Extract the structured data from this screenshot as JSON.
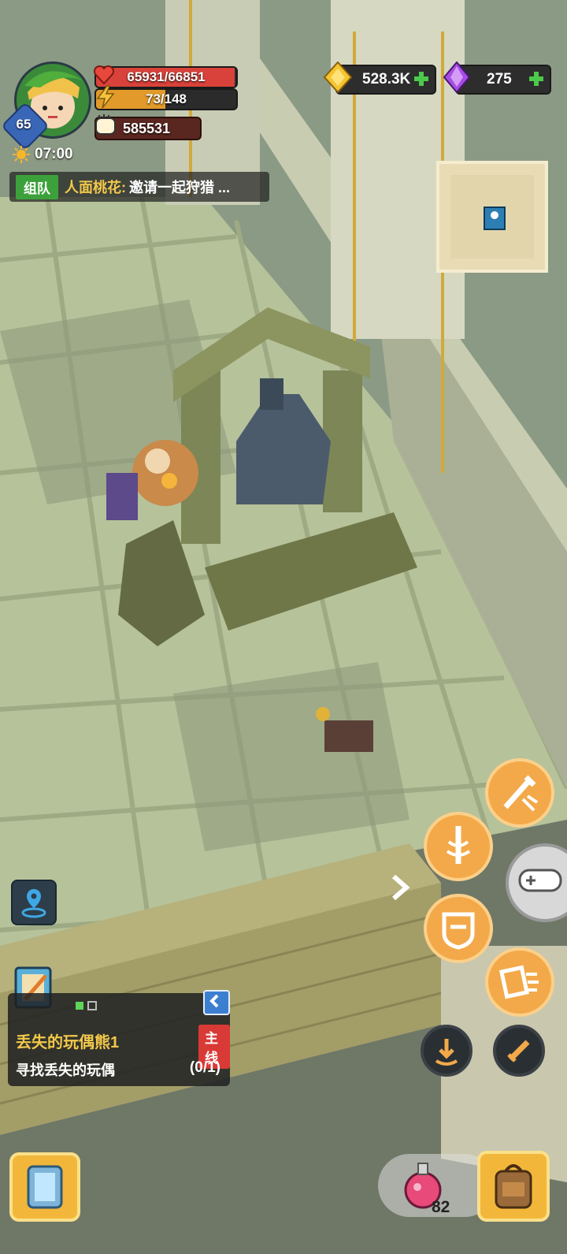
{
  "player": {
    "level": "65",
    "hp_text": "65931/66851",
    "hp_fraction": 0.986,
    "energy_text": "73/148",
    "energy_fraction": 0.493,
    "power": "585531",
    "time": "07:00"
  },
  "chat": {
    "channel": "组队",
    "sender": "人面桃花:",
    "message": "邀请一起狩猎 ..."
  },
  "currency": {
    "gold": "528.3K",
    "gems": "275"
  },
  "quest": {
    "title": "丢失的玩偶熊1",
    "tag": "主线",
    "description": "寻找丢失的玩偶",
    "progress": "(0/1)"
  },
  "inventory": {
    "potion_count": "82"
  },
  "icons": [
    "heart-icon",
    "lightning-icon",
    "power-fist-icon",
    "sun-icon",
    "gold-coin-icon",
    "gem-icon",
    "plus-icon",
    "map-pin-icon",
    "location-icon",
    "sword-attack-icon",
    "sword-spin-icon",
    "shield-icon",
    "card-icon",
    "gamepad-icon",
    "arrow-right-icon",
    "dodge-icon",
    "weapon-swap-icon",
    "portal-icon",
    "potion-icon",
    "backpack-icon",
    "quest-scroll-icon"
  ]
}
